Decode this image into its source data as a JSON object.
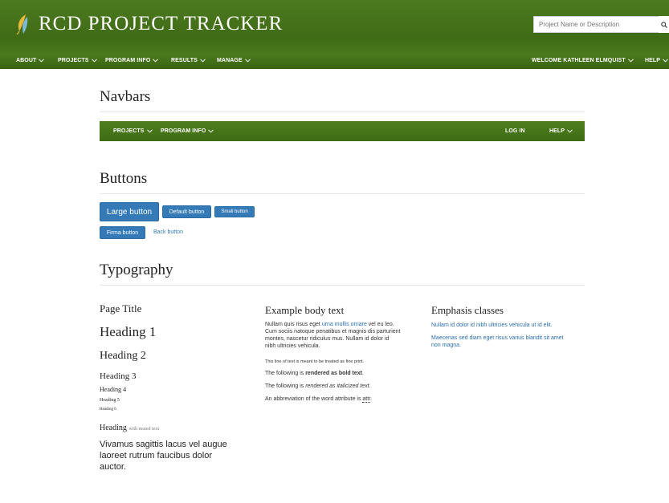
{
  "header": {
    "brand": "RCD PROJECT TRACKER",
    "search_placeholder": "Project Name or Description"
  },
  "main_nav": {
    "about": "ABOUT",
    "projects": "PROJECTS",
    "program_info": "PROGRAM INFO",
    "results": "RESULTS",
    "manage": "MANAGE",
    "welcome": "WELCOME KATHLEEN ELMQUIST",
    "help": "HELP"
  },
  "sections": {
    "navbars": "Navbars",
    "buttons": "Buttons",
    "typography": "Typography"
  },
  "demo_nav": {
    "projects": "PROJECTS",
    "program_info": "PROGRAM INFO",
    "login": "LOG IN",
    "help": "HELP"
  },
  "buttons": {
    "large": "Large button",
    "default": "Default button",
    "small": "Small button",
    "firma": "Firma button",
    "back": "Back button"
  },
  "typography": {
    "page_title": "Page Title",
    "h1": "Heading 1",
    "h2": "Heading 2",
    "h3": "Heading 3",
    "h4": "Heading 4",
    "h5": "Heading 5",
    "h6": "Heading 6",
    "muted_heading": "Heading",
    "muted_text": "with muted text",
    "lead_line1": "Vivamus sagittis lacus vel augue",
    "lead_line2": "laoreet rutrum faucibus dolor",
    "lead_line3": "auctor."
  },
  "body_text": {
    "title": "Example body text",
    "p1_start": "Nullam quis risus eget ",
    "p1_link": "urna mollis ornare",
    "p1_end": " vel eu leo.",
    "p1_line2": "Cum sociis natoque penatibus et magnis dis parturient",
    "p1_line3": "montes, nascetur ridiculus mus. Nullam id dolor id",
    "p1_line4": "nibh ultricies vehicula.",
    "fine_print": "This line of text is meant to be treated as fine print.",
    "bold_prefix": "The following is ",
    "bold_text": "rendered as bold text",
    "italic_prefix": "The following is ",
    "italic_text": "rendered as italicized text",
    "abbr_prefix": "An abbreviation of the word attribute is ",
    "abbr": "attr"
  },
  "emphasis": {
    "title": "Emphasis classes",
    "line1": "Nullam id dolor id nibh ultricies vehicula ut id elit.",
    "line2a": "Maecenas sed diam eget risus varius blandit sit amet",
    "line2b": "non magna."
  },
  "colors": {
    "header_green": "#3f6b16",
    "button_blue": "#337ab7",
    "link_blue": "#2a6ead"
  }
}
